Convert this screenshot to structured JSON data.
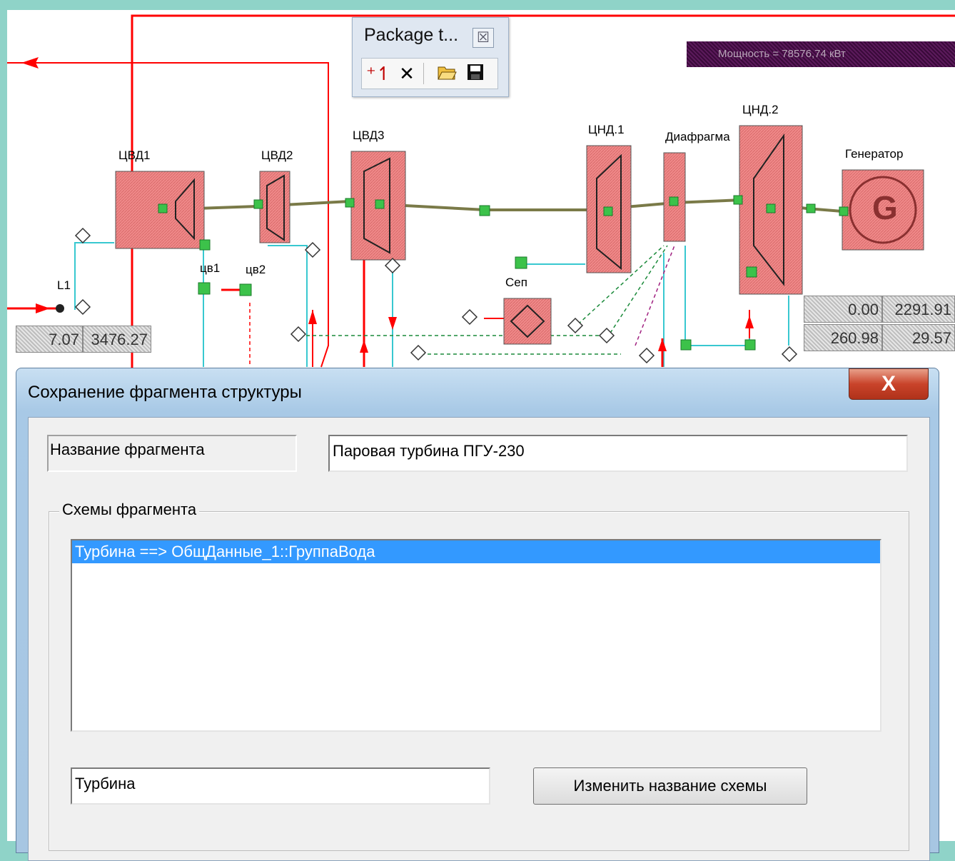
{
  "diagram": {
    "blocks": {
      "cvd1": "ЦВД1",
      "cvd2": "ЦВД2",
      "cvd3": "ЦВД3",
      "cnd1": "ЦНД.1",
      "cnd2": "ЦНД.2",
      "diaphragm": "Диафрагма",
      "generator": "Генератор",
      "generator_symbol": "G",
      "cv1": "цв1",
      "cv2": "цв2",
      "sep": "Сеп",
      "l1": "L1"
    },
    "power_text": "Мощность  =  78576,74  кВт",
    "values": {
      "left_1": "7.07",
      "left_2": "3476.27",
      "right_1": "0.00",
      "right_2": "2291.91",
      "right_3": "260.98",
      "right_4": "29.57"
    },
    "colors": {
      "block_fill": "#f08a8a",
      "pipe_red": "#ff0000",
      "pipe_cyan": "#38c8d0",
      "shaft": "#7a7a48",
      "node_green": "#3cc24a"
    }
  },
  "package_toolbar": {
    "title": "Package t...",
    "close_icon": "close-icon",
    "buttons": [
      "new-package-icon",
      "delete-icon",
      "open-folder-icon",
      "save-icon"
    ]
  },
  "dialog": {
    "title": "Сохранение фрагмента структуры",
    "close_label": "X",
    "fragment_name_label": "Название фрагмента",
    "fragment_name_value": "Паровая турбина ПГУ-230",
    "schemes_group_label": "Схемы фрагмента",
    "schemes": [
      "Турбина ==> ОбщДанные_1::ГруппаВода"
    ],
    "selected_scheme_index": 0,
    "scheme_name_value": "Турбина",
    "rename_button_label": "Изменить название схемы"
  }
}
